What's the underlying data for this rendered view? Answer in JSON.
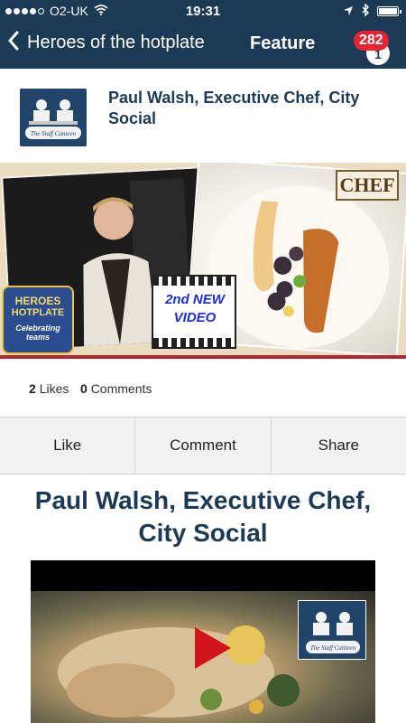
{
  "status_bar": {
    "carrier": "O2-UK",
    "time": "19:31",
    "battery_level": 1.0
  },
  "nav": {
    "back_label": "Heroes of the hotplate",
    "title": "Feature",
    "notification_count": "282",
    "notification_text": "1"
  },
  "post": {
    "title": "Paul Walsh, Executive Chef, City Social",
    "feature_image": {
      "badge_line1": "HEROES",
      "badge_line2": "HOTPLATE",
      "badge_tagline": "Celebrating teams",
      "video_badge": "2nd NEW VIDEO",
      "brand_logo": "CHEF"
    },
    "stats": {
      "likes_count": "2",
      "likes_label": "Likes",
      "comments_count": "0",
      "comments_label": "Comments"
    },
    "actions": {
      "like": "Like",
      "comment": "Comment",
      "share": "Share"
    }
  },
  "article": {
    "title": "Paul Walsh, Executive Chef, City Social",
    "video_logo_text": "The Staff Canteen"
  },
  "logo": {
    "text": "The Staff Canteen"
  },
  "colors": {
    "navy": "#1d3a55",
    "badge_red": "#e52532",
    "accent_red": "#b3262e",
    "action_bar_bg": "#f2f2f2"
  },
  "icons": [
    "back-chevron-icon",
    "wifi-icon",
    "location-arrow-icon",
    "bluetooth-icon",
    "battery-icon",
    "play-icon"
  ]
}
